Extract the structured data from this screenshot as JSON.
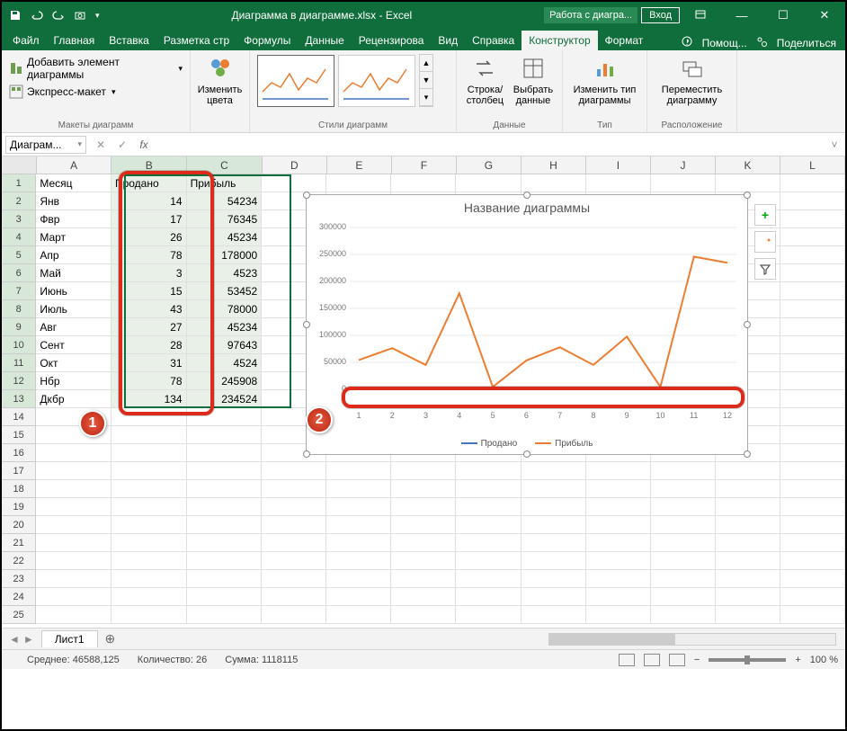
{
  "titlebar": {
    "doc_title": "Диаграмма в диаграмме.xlsx - Excel",
    "tools_label": "Работа с диагра...",
    "login": "Вход"
  },
  "tabs": {
    "file": "Файл",
    "home": "Главная",
    "insert": "Вставка",
    "layout": "Разметка стр",
    "formulas": "Формулы",
    "data": "Данные",
    "review": "Рецензирова",
    "view": "Вид",
    "help": "Справка",
    "design": "Конструктор",
    "format": "Формат",
    "tellme": "Помощ...",
    "share": "Поделиться"
  },
  "ribbon": {
    "add_element": "Добавить элемент диаграммы",
    "quick_layout": "Экспресс-макет",
    "layouts_label": "Макеты диаграмм",
    "change_colors": "Изменить цвета",
    "styles_label": "Стили диаграмм",
    "switch_rowcol": "Строка/ столбец",
    "select_data": "Выбрать данные",
    "data_label": "Данные",
    "change_type": "Изменить тип диаграммы",
    "type_label": "Тип",
    "move_chart": "Переместить диаграмму",
    "location_label": "Расположение"
  },
  "formula_bar": {
    "name": "Диаграм...",
    "fx": "fx"
  },
  "columns": [
    "A",
    "B",
    "C",
    "D",
    "E",
    "F",
    "G",
    "H",
    "I",
    "J",
    "K",
    "L"
  ],
  "headers": {
    "month": "Месяц",
    "sold": "Продано",
    "profit": "Прибыль"
  },
  "rows": [
    {
      "m": "Янв",
      "s": 14,
      "p": 54234
    },
    {
      "m": "Фвр",
      "s": 17,
      "p": 76345
    },
    {
      "m": "Март",
      "s": 26,
      "p": 45234
    },
    {
      "m": "Апр",
      "s": 78,
      "p": 178000
    },
    {
      "m": "Май",
      "s": 3,
      "p": 4523
    },
    {
      "m": "Июнь",
      "s": 15,
      "p": 53452
    },
    {
      "m": "Июль",
      "s": 43,
      "p": 78000
    },
    {
      "m": "Авг",
      "s": 27,
      "p": 45234
    },
    {
      "m": "Сент",
      "s": 28,
      "p": 97643
    },
    {
      "m": "Окт",
      "s": 31,
      "p": 4524
    },
    {
      "m": "Нбр",
      "s": 78,
      "p": 245908
    },
    {
      "m": "Дкбр",
      "s": 134,
      "p": 234524
    }
  ],
  "chart": {
    "title": "Название диаграммы",
    "legend1": "Продано",
    "legend2": "Прибыль",
    "color1": "#4472c4",
    "color2": "#ed7d31"
  },
  "chart_data": {
    "type": "line",
    "title": "Название диаграммы",
    "x": [
      1,
      2,
      3,
      4,
      5,
      6,
      7,
      8,
      9,
      10,
      11,
      12
    ],
    "series": [
      {
        "name": "Продано",
        "color": "#4472c4",
        "values": [
          14,
          17,
          26,
          78,
          3,
          15,
          43,
          27,
          28,
          31,
          78,
          134
        ]
      },
      {
        "name": "Прибыль",
        "color": "#ed7d31",
        "values": [
          54234,
          76345,
          45234,
          178000,
          4523,
          53452,
          78000,
          45234,
          97643,
          4524,
          245908,
          234524
        ]
      }
    ],
    "ylim": [
      0,
      300000
    ],
    "yticks": [
      0,
      50000,
      100000,
      150000,
      200000,
      250000,
      300000
    ],
    "xlabel": "",
    "ylabel": ""
  },
  "badges": {
    "one": "1",
    "two": "2"
  },
  "sheet": {
    "name": "Лист1"
  },
  "status": {
    "avg_label": "Среднее:",
    "avg_val": "46588,125",
    "count_label": "Количество:",
    "count_val": "26",
    "sum_label": "Сумма:",
    "sum_val": "1118115",
    "zoom": "100 %"
  }
}
